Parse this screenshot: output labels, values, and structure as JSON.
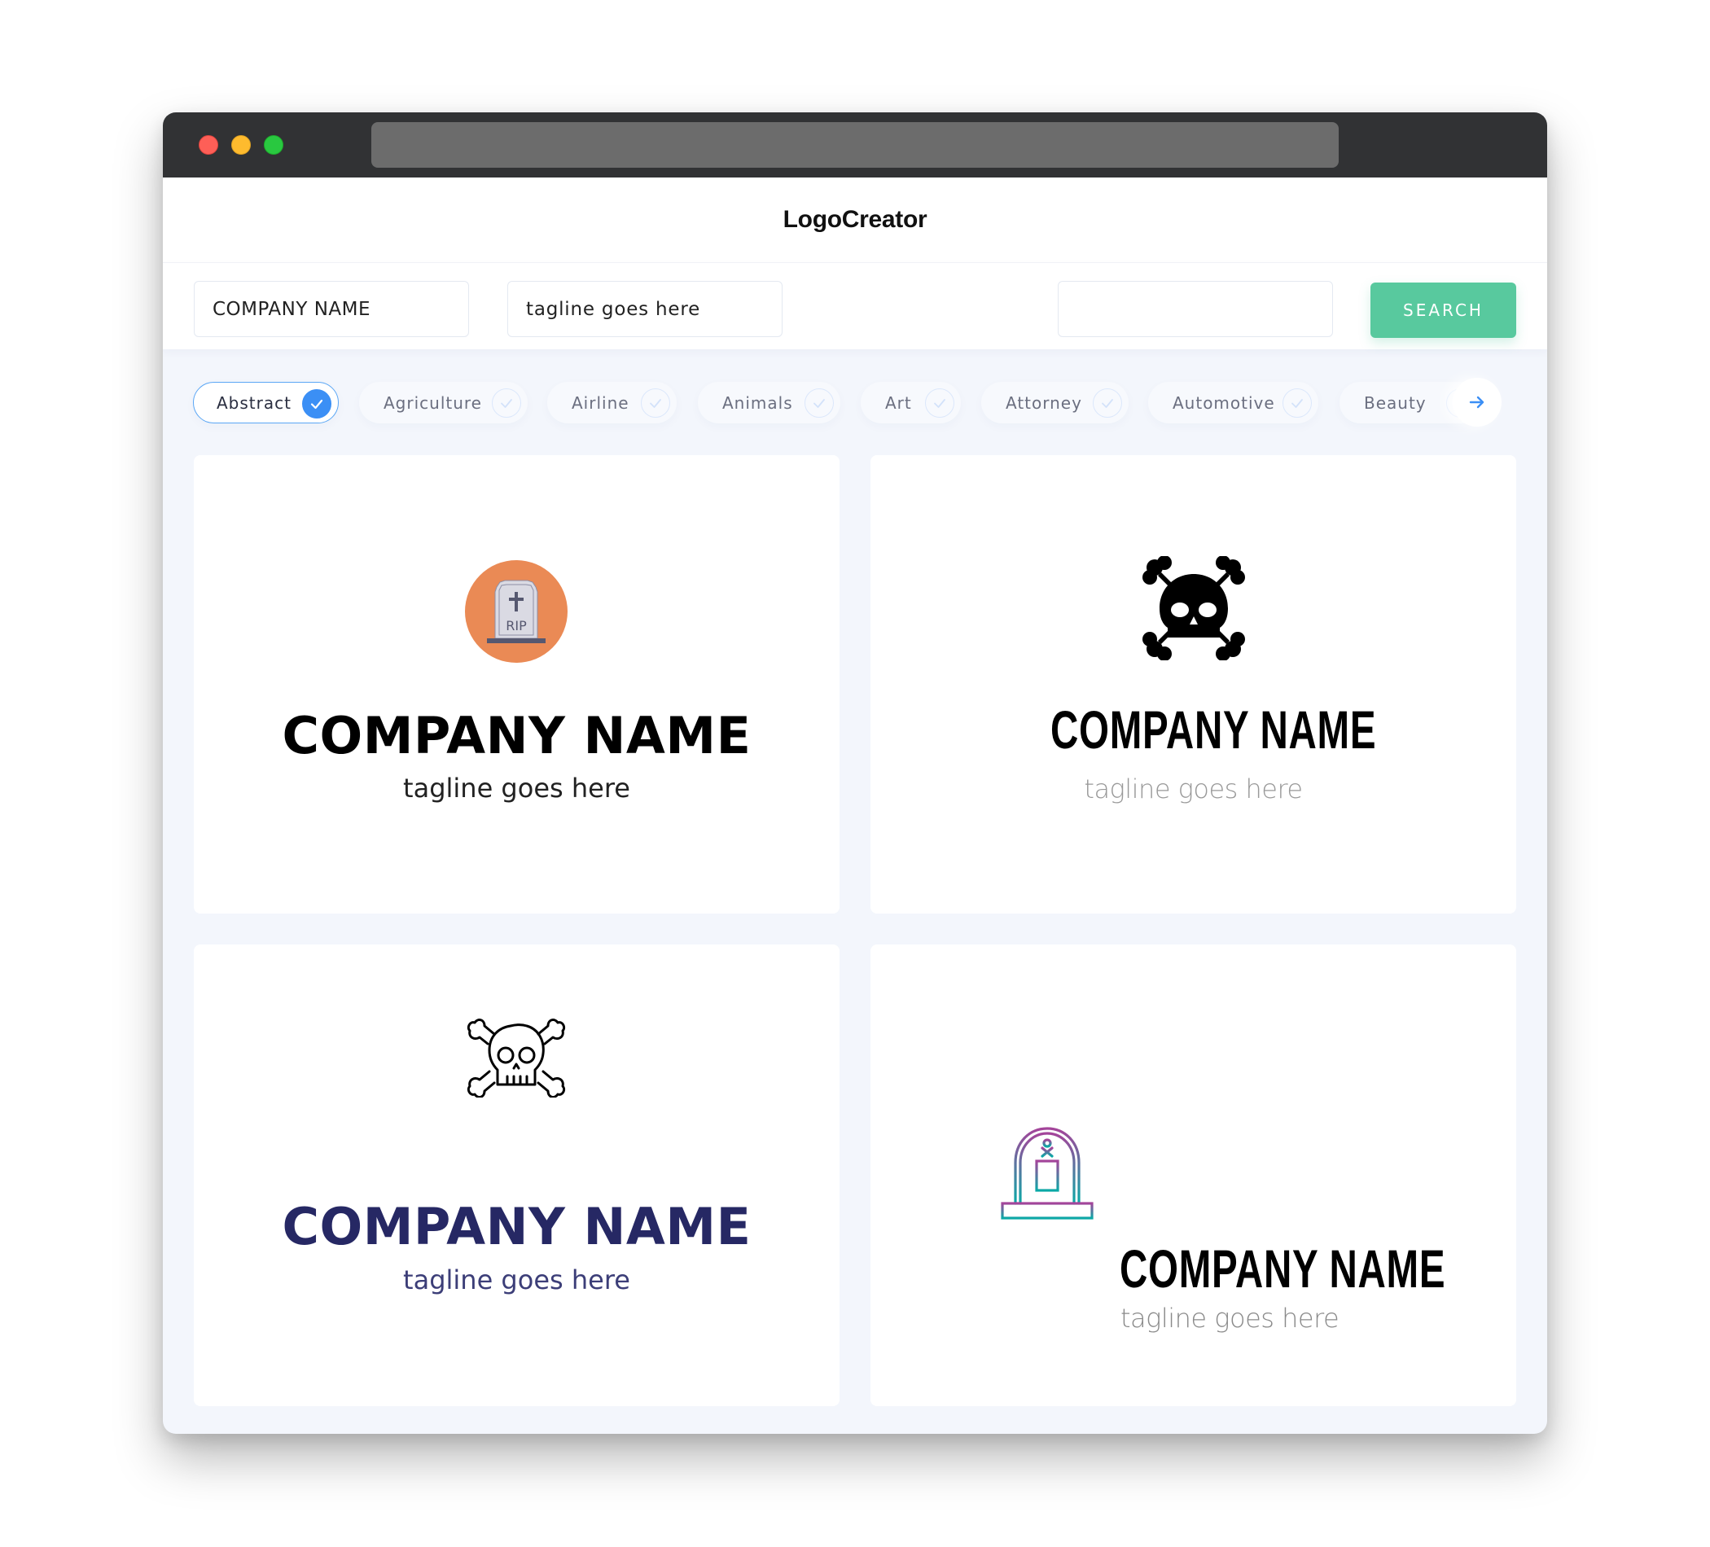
{
  "app": {
    "title": "LogoCreator"
  },
  "window": {
    "traffic_lights": [
      "close",
      "minimize",
      "maximize"
    ]
  },
  "search": {
    "company_value": "COMPANY NAME",
    "tagline_value": "tagline goes here",
    "extra_value": "",
    "button_label": "SEARCH",
    "accent_color": "#58c99e"
  },
  "categories": {
    "items": [
      {
        "label": "Abstract",
        "selected": true
      },
      {
        "label": "Agriculture",
        "selected": false
      },
      {
        "label": "Airline",
        "selected": false
      },
      {
        "label": "Animals",
        "selected": false
      },
      {
        "label": "Art",
        "selected": false
      },
      {
        "label": "Attorney",
        "selected": false
      },
      {
        "label": "Automotive",
        "selected": false
      },
      {
        "label": "Beauty",
        "selected": false
      }
    ],
    "next_icon": "arrow-right-icon",
    "selected_color": "#3b8ff5"
  },
  "logos": [
    {
      "icon": "tombstone-rip-icon",
      "icon_text": "RIP",
      "name": "COMPANY NAME",
      "tagline": "tagline goes here",
      "name_color": "#000000",
      "tagline_color": "#222222",
      "icon_bg": "#ea8a55"
    },
    {
      "icon": "skull-crossbones-solid-icon",
      "name": "COMPANY NAME",
      "tagline": "tagline goes here",
      "name_color": "#000000",
      "tagline_color": "#999999"
    },
    {
      "icon": "skull-crossbones-outline-icon",
      "name": "COMPANY NAME",
      "tagline": "tagline goes here",
      "name_color": "#262864",
      "tagline_color": "#3c3e78"
    },
    {
      "icon": "tombstone-gradient-icon",
      "name": "COMPANY NAME",
      "tagline": "tagline goes here",
      "name_color": "#000000",
      "tagline_color": "#8a8a8a",
      "gradient": [
        "#a4449a",
        "#0aa9a6"
      ]
    }
  ]
}
